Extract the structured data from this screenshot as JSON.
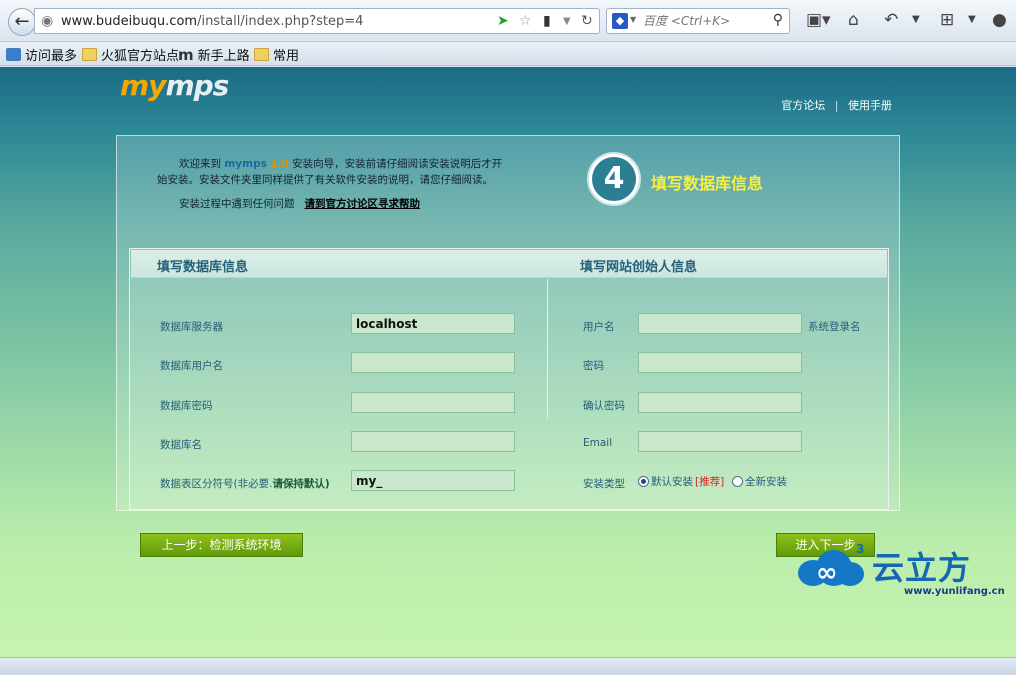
{
  "browser": {
    "url_host": "www.budeibuqu.com",
    "url_path": "/install/index.php?step=4",
    "search_placeholder": "百度 <Ctrl+K>",
    "bookmarks": [
      {
        "label": "访问最多",
        "icon": "most-visited-icon"
      },
      {
        "label": "火狐官方站点",
        "icon": "folder-icon"
      },
      {
        "label": "新手上路",
        "icon": "m-icon"
      },
      {
        "label": "常用",
        "icon": "folder-icon"
      }
    ]
  },
  "header": {
    "logo_my": "my",
    "logo_mps": "mps",
    "links": [
      "官方论坛",
      "|",
      "使用手册"
    ]
  },
  "intro": {
    "welcome_pre": "欢迎来到",
    "brand": "mymps",
    "version": "1.0",
    "welcome_post": "安装向导，安装前请仔细阅读安装说明后才开始安装。安装文件夹里同样提供了有关软件安装的说明，请您仔细阅读。",
    "problem": "安装过程中遇到任何问题",
    "help_link": "请到官方讨论区寻求帮助"
  },
  "step": {
    "number": "4",
    "title": "填写数据库信息"
  },
  "form": {
    "db_heading": "填写数据库信息",
    "admin_heading": "填写网站创始人信息",
    "db_fields": [
      {
        "label": "数据库服务器",
        "value": "localhost"
      },
      {
        "label": "数据库用户名",
        "value": ""
      },
      {
        "label": "数据库密码",
        "value": ""
      },
      {
        "label": "数据库名",
        "value": ""
      },
      {
        "label_pre": "数据表区分符号(非必要.",
        "label_em": "请保持默认)",
        "value": "my_"
      }
    ],
    "admin_fields": [
      {
        "label": "用户名",
        "value": "",
        "hint": "系统登录名"
      },
      {
        "label": "密码",
        "value": ""
      },
      {
        "label": "确认密码",
        "value": ""
      },
      {
        "label": "Email",
        "value": ""
      }
    ],
    "install_type": {
      "label": "安装类型",
      "option1": "默认安装",
      "option1_tag": "[推荐]",
      "option2": "全新安装",
      "selected": "默认安装"
    }
  },
  "buttons": {
    "prev": "上一步：检测系统环境",
    "next": "进入下一步"
  },
  "watermark": {
    "superscript": "3",
    "brand": "云立方",
    "url": "www.yunlifang.cn"
  },
  "colors": {
    "accent_yellow": "#f7ef44",
    "button_green": "#6fa812",
    "logo_orange": "#f5a800"
  }
}
